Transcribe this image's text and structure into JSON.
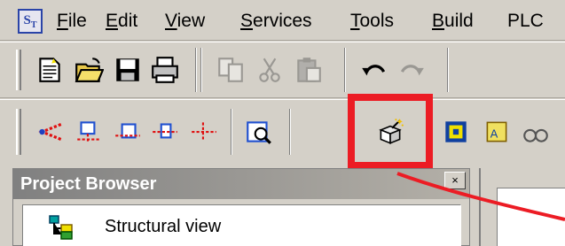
{
  "app": {
    "icon_label": "ST"
  },
  "menu": {
    "items": [
      {
        "accel": "F",
        "rest": "ile"
      },
      {
        "accel": "E",
        "rest": "dit"
      },
      {
        "accel": "V",
        "rest": "iew"
      },
      {
        "accel": "S",
        "rest": "ervices"
      },
      {
        "accel": "T",
        "rest": "ools"
      },
      {
        "accel": "B",
        "rest": "uild"
      },
      {
        "accel": "",
        "rest": "PLC"
      }
    ]
  },
  "toolbar1": {
    "buttons": [
      "new-icon",
      "open-icon",
      "save-icon",
      "print-icon",
      "copy-icon",
      "cut-icon",
      "paste-icon",
      "undo-icon",
      "redo-icon"
    ]
  },
  "toolbar2": {
    "buttons": [
      "connect-icon",
      "network-icon",
      "download-icon",
      "upload-icon",
      "compare-icon",
      "monitor-icon",
      "magic-icon",
      "pou-icon",
      "variable-icon",
      "watch-icon"
    ],
    "highlighted": "magic-icon"
  },
  "project_browser": {
    "title": "Project Browser",
    "close_label": "×",
    "tree": [
      {
        "icon": "structural-view-icon",
        "label": "Structural view"
      }
    ]
  },
  "annotation": {
    "color": "#ec1c24"
  }
}
